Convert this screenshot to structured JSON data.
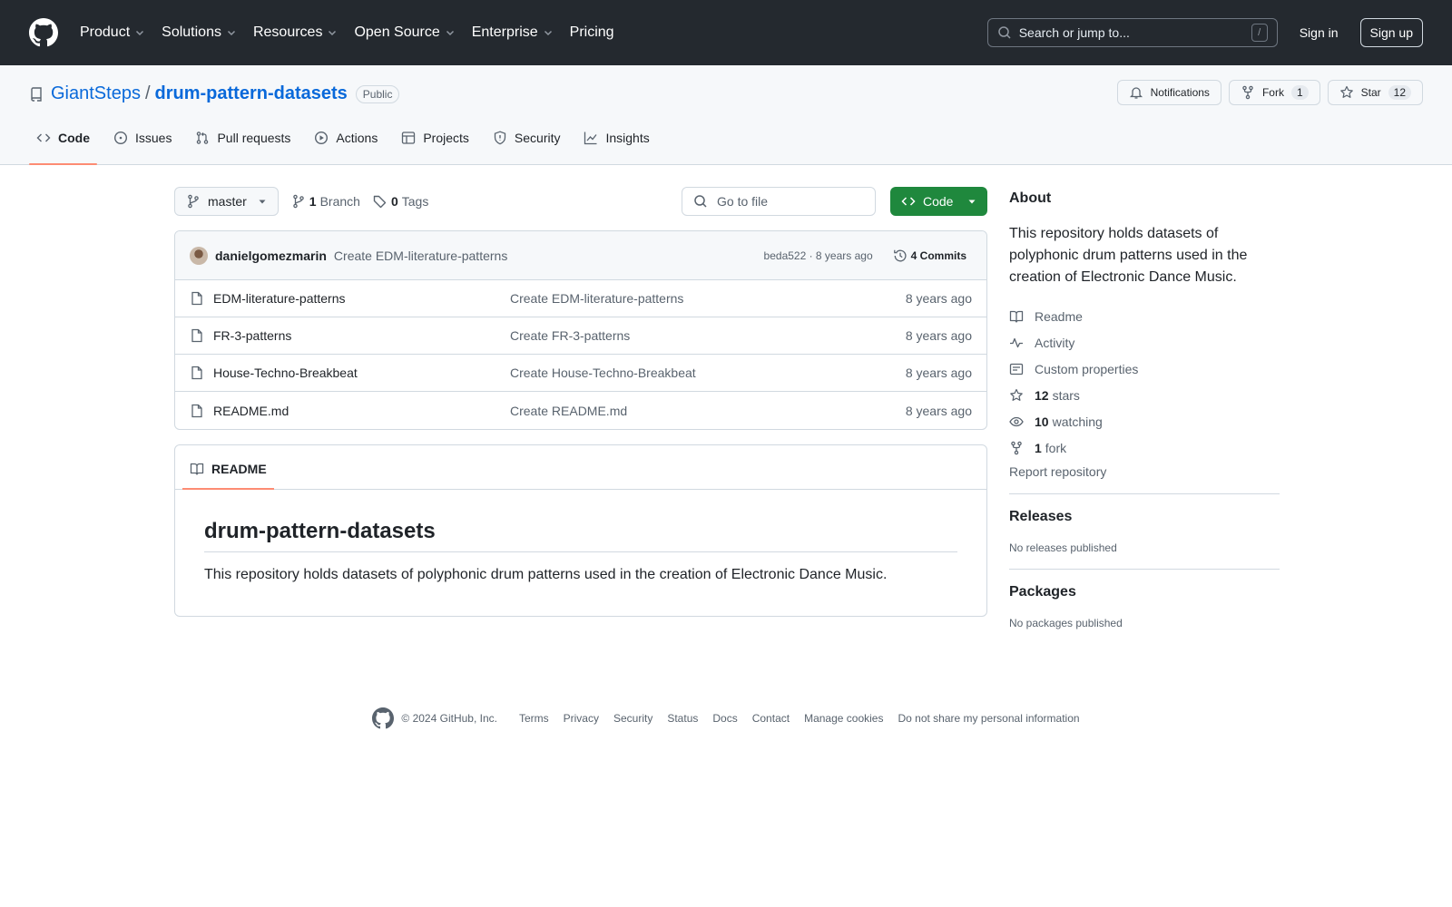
{
  "header": {
    "nav": [
      {
        "label": "Product",
        "dropdown": true
      },
      {
        "label": "Solutions",
        "dropdown": true
      },
      {
        "label": "Resources",
        "dropdown": true
      },
      {
        "label": "Open Source",
        "dropdown": true
      },
      {
        "label": "Enterprise",
        "dropdown": true
      },
      {
        "label": "Pricing",
        "dropdown": false
      }
    ],
    "search_placeholder": "Search or jump to...",
    "search_shortcut": "/",
    "sign_in": "Sign in",
    "sign_up": "Sign up"
  },
  "repo": {
    "owner": "GiantSteps",
    "separator": "/",
    "name": "drum-pattern-datasets",
    "visibility": "Public",
    "actions": {
      "notifications": "Notifications",
      "fork_label": "Fork",
      "fork_count": "1",
      "star_label": "Star",
      "star_count": "12"
    },
    "tabs": [
      {
        "label": "Code",
        "icon": "code-icon",
        "active": true
      },
      {
        "label": "Issues",
        "icon": "issue-icon",
        "active": false
      },
      {
        "label": "Pull requests",
        "icon": "pull-request-icon",
        "active": false
      },
      {
        "label": "Actions",
        "icon": "play-icon",
        "active": false
      },
      {
        "label": "Projects",
        "icon": "table-icon",
        "active": false
      },
      {
        "label": "Security",
        "icon": "shield-icon",
        "active": false
      },
      {
        "label": "Insights",
        "icon": "graph-icon",
        "active": false
      }
    ]
  },
  "toolbar": {
    "branch": "master",
    "branch_count": "1",
    "branch_label": "Branch",
    "tag_count": "0",
    "tag_label": "Tags",
    "goto_placeholder": "Go to file",
    "code_button": "Code"
  },
  "commit": {
    "author": "danielgomezmarin",
    "message": "Create EDM-literature-patterns",
    "hash_time": "beda522 · 8 years ago",
    "commits": "4 Commits"
  },
  "files": [
    {
      "name": "EDM-literature-patterns",
      "message": "Create EDM-literature-patterns",
      "age": "8 years ago"
    },
    {
      "name": "FR-3-patterns",
      "message": "Create FR-3-patterns",
      "age": "8 years ago"
    },
    {
      "name": "House-Techno-Breakbeat",
      "message": "Create House-Techno-Breakbeat",
      "age": "8 years ago"
    },
    {
      "name": "README.md",
      "message": "Create README.md",
      "age": "8 years ago"
    }
  ],
  "readme": {
    "tab_label": "README",
    "heading": "drum-pattern-datasets",
    "body": "This repository holds datasets of polyphonic drum patterns used in the creation of Electronic Dance Music."
  },
  "about": {
    "title": "About",
    "description": "This repository holds datasets of polyphonic drum patterns used in the creation of Electronic Dance Music.",
    "links": {
      "readme": "Readme",
      "activity": "Activity",
      "custom_properties": "Custom properties",
      "stars_count": "12",
      "stars_label": "stars",
      "watching_count": "10",
      "watching_label": "watching",
      "fork_count": "1",
      "fork_label": "fork"
    },
    "report": "Report repository"
  },
  "releases": {
    "title": "Releases",
    "text": "No releases published"
  },
  "packages": {
    "title": "Packages",
    "text": "No packages published"
  },
  "footer": {
    "copyright": "© 2024 GitHub, Inc.",
    "links": [
      "Terms",
      "Privacy",
      "Security",
      "Status",
      "Docs",
      "Contact",
      "Manage cookies",
      "Do not share my personal information"
    ]
  },
  "colors": {
    "header_bg": "#24292f",
    "link": "#0969da",
    "primary_button": "#1f883d",
    "active_tab_underline": "#fd8c73"
  }
}
